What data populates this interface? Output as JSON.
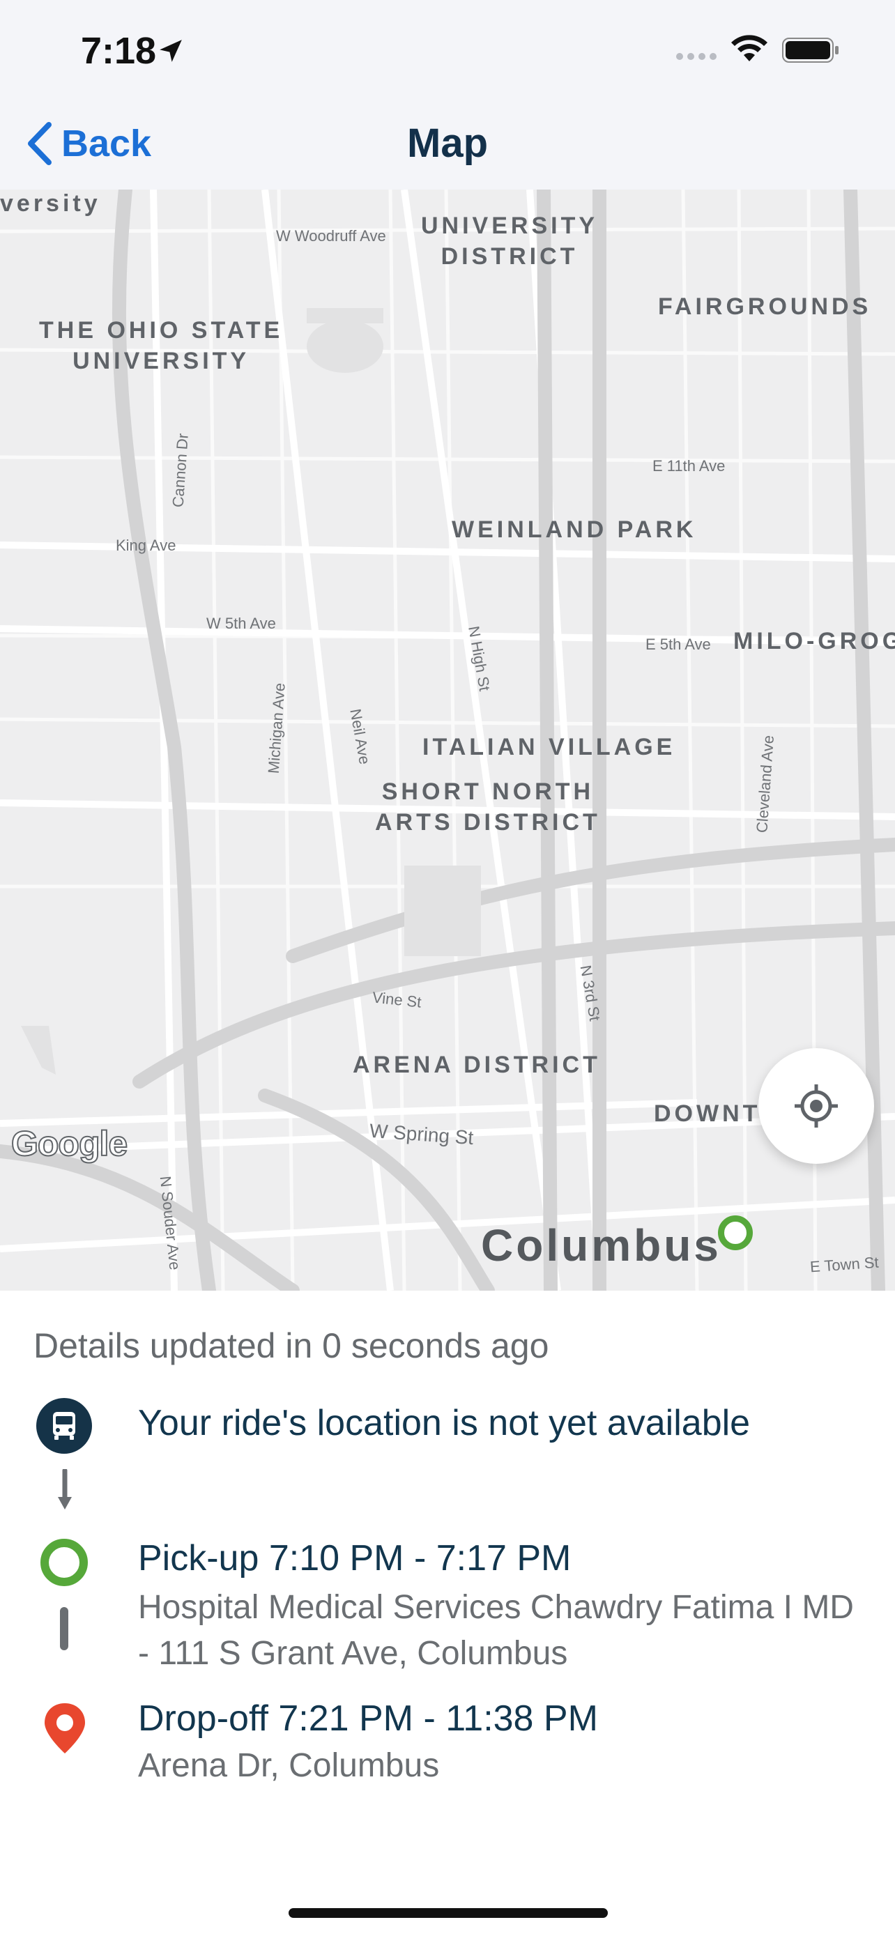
{
  "status_bar": {
    "time": "7:18",
    "icons": [
      "location-arrow-icon",
      "cellular-dots-icon",
      "wifi-icon",
      "battery-icon"
    ]
  },
  "nav": {
    "back_label": "Back",
    "title": "Map"
  },
  "map": {
    "area_labels": [
      "versity",
      "UNIVERSITY\nDISTRICT",
      "FAIRGROUNDS",
      "THE OHIO STATE\nUNIVERSITY",
      "WEINLAND PARK",
      "MILO-GROG",
      "ITALIAN VILLAGE",
      "SHORT NORTH\nARTS DISTRICT",
      "ARENA DISTRICT",
      "DOWNT"
    ],
    "street_labels": [
      "W Woodruff Ave",
      "Cannon Dr",
      "E 11th Ave",
      "King Ave",
      "W 5th Ave",
      "N High St",
      "E 5th Ave",
      "Michigan Ave",
      "Neil Ave",
      "Cleveland Ave",
      "Vine St",
      "N 3rd St",
      "W Spring St",
      "N Souder Ave",
      "E Town St"
    ],
    "city_label": "Columbus",
    "attribution": "Google",
    "recenter_icon": "crosshair-icon"
  },
  "details": {
    "updated_text": "Details updated in 0 seconds ago",
    "ride_status": "Your ride's location is not yet available",
    "pickup_title": "Pick-up 7:10 PM - 7:17 PM",
    "pickup_address": "Hospital Medical Services Chawdry Fatima I MD - 111 S Grant Ave, Columbus",
    "dropoff_title": "Drop-off 7:21 PM - 11:38 PM",
    "dropoff_address": "Arena Dr, Columbus"
  },
  "colors": {
    "accent": "#1c6fd6",
    "navy": "#12364e",
    "pickup_green": "#56a83a",
    "dropoff_red": "#e8472e"
  }
}
